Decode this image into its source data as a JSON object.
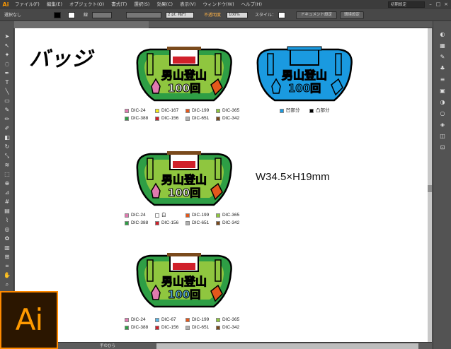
{
  "app": {
    "name": "Ai",
    "brand_color": "#ff9a00"
  },
  "menubar": {
    "items": [
      "ファイル(F)",
      "編集(E)",
      "オブジェクト(O)",
      "書式(T)",
      "選択(S)",
      "効果(C)",
      "表示(V)",
      "ウィンドウ(W)",
      "ヘルプ(H)"
    ],
    "workspace": "初期設定"
  },
  "controlbar": {
    "selection": "選択なし",
    "stroke_label": "線",
    "stroke_width": "2 pt. 楕円",
    "opacity_label": "不透明度",
    "opacity_value": "100%",
    "style_label": "スタイル：",
    "doc_setup": "ドキュメント設定",
    "prefs": "環境設定"
  },
  "statusbar": {
    "tool": "手のひら"
  },
  "artboard": {
    "title": "バッジ",
    "dimensions": "W34.5×H19mm",
    "badge_text_line1": "男山登山",
    "badge_text_line2": "100回"
  },
  "legends": [
    {
      "items": [
        {
          "label": "DIC-24",
          "color": "#e07ab0"
        },
        {
          "label": "DIC-167",
          "color": "#f5ea1c"
        },
        {
          "label": "DIC-199",
          "color": "#e3581c"
        },
        {
          "label": "DIC-365",
          "color": "#8fc63f"
        },
        {
          "label": "DIC-388",
          "color": "#2e9e45"
        },
        {
          "label": "DIC-156",
          "color": "#d0202a"
        },
        {
          "label": "DIC-651",
          "color": "#b0b0b0"
        },
        {
          "label": "DIC-342",
          "color": "#7a4a1c"
        }
      ]
    },
    {
      "items": [
        {
          "label": "DIC-24",
          "color": "#e07ab0"
        },
        {
          "label": "白",
          "color": "#ffffff"
        },
        {
          "label": "DIC-199",
          "color": "#e3581c"
        },
        {
          "label": "DIC-365",
          "color": "#8fc63f"
        },
        {
          "label": "DIC-388",
          "color": "#2e9e45"
        },
        {
          "label": "DIC-156",
          "color": "#d0202a"
        },
        {
          "label": "DIC-651",
          "color": "#b0b0b0"
        },
        {
          "label": "DIC-342",
          "color": "#7a4a1c"
        }
      ]
    },
    {
      "items": [
        {
          "label": "DIC-24",
          "color": "#e07ab0"
        },
        {
          "label": "DIC-67",
          "color": "#59b6e6"
        },
        {
          "label": "DIC-199",
          "color": "#e3581c"
        },
        {
          "label": "DIC-365",
          "color": "#8fc63f"
        },
        {
          "label": "DIC-388",
          "color": "#2e9e45"
        },
        {
          "label": "DIC-156",
          "color": "#d0202a"
        },
        {
          "label": "DIC-651",
          "color": "#b0b0b0"
        },
        {
          "label": "DIC-342",
          "color": "#7a4a1c"
        }
      ]
    }
  ],
  "mold_legend": {
    "items": [
      {
        "label": "凹部分",
        "color": "#1a9ae0"
      },
      {
        "label": "凸部分",
        "color": "#000000"
      }
    ]
  },
  "badge_colors": {
    "green_light": "#8fc63f",
    "green_dark": "#2e9e45",
    "yellow": "#f5ea1c",
    "white": "#ffffff",
    "light_blue": "#59b6e6",
    "mold_blue": "#1a9ae0"
  }
}
